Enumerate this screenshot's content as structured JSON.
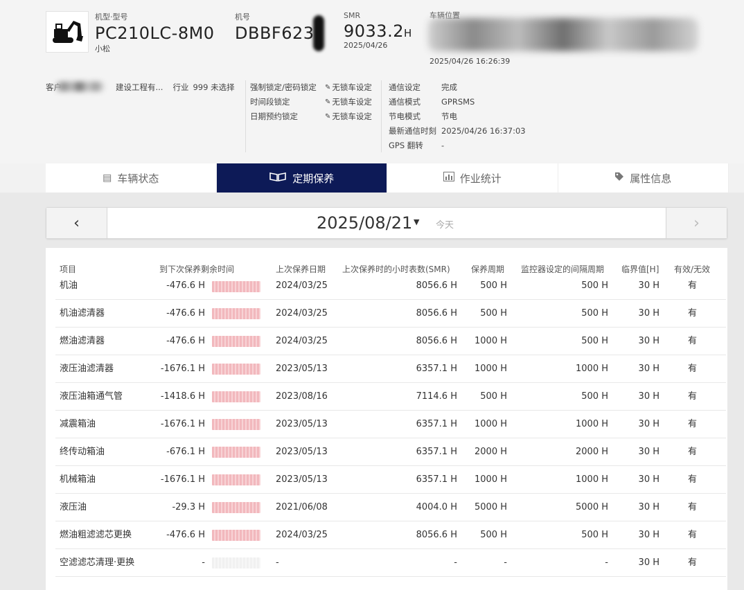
{
  "colors": {
    "active_tab": "#0d1a57",
    "bar": "#f2b8bd"
  },
  "vehicle": {
    "model_label": "机型·型号",
    "model": "PC210LC-8M0",
    "maker": "小松",
    "machine_no_label": "机号",
    "machine_no": "DBBF623",
    "smr_label": "SMR",
    "smr_value": "9033.2",
    "smr_unit": "H",
    "smr_date": "2025/04/26",
    "location_label": "车辆位置",
    "location_time": "2025/04/26 16:26:39"
  },
  "info": {
    "customer_label": "客户",
    "customer_value": "建设工程有...",
    "industry_label": "行业",
    "industry_value": "999 未选择",
    "locks": [
      {
        "label": "强制锁定/密码锁定",
        "value": "无锁车设定"
      },
      {
        "label": "时间段锁定",
        "value": "无锁车设定"
      },
      {
        "label": "日期预约锁定",
        "value": "无锁车设定"
      }
    ],
    "comm": [
      {
        "label": "通信设定",
        "value": "完成"
      },
      {
        "label": "通信模式",
        "value": "GPRSMS"
      },
      {
        "label": "节电模式",
        "value": "节电"
      },
      {
        "label": "最新通信时刻",
        "value": "2025/04/26 16:37:03"
      },
      {
        "label": "GPS 翻转",
        "value": "-"
      }
    ]
  },
  "tabs": [
    {
      "label": "车辆状态",
      "icon": "document-icon"
    },
    {
      "label": "定期保养",
      "icon": "book-icon"
    },
    {
      "label": "作业统计",
      "icon": "bar-chart-icon"
    },
    {
      "label": "属性信息",
      "icon": "tag-icon"
    }
  ],
  "datebar": {
    "date": "2025/08/21",
    "today": "今天"
  },
  "table": {
    "headers": [
      "项目",
      "到下次保养剩余时间",
      "上次保养日期",
      "上次保养时的小时表数(SMR)",
      "保养周期",
      "监控器设定的间隔周期",
      "临界值[H]",
      "有效/无效"
    ],
    "rows": [
      {
        "item": "机油",
        "remain": "-476.6 H",
        "last_date": "2024/03/25",
        "smr": "8056.6 H",
        "cycle": "500 H",
        "monitor": "500 H",
        "limit": "30 H",
        "valid": "有"
      },
      {
        "item": "机油滤清器",
        "remain": "-476.6 H",
        "last_date": "2024/03/25",
        "smr": "8056.6 H",
        "cycle": "500 H",
        "monitor": "500 H",
        "limit": "30 H",
        "valid": "有"
      },
      {
        "item": "燃油滤清器",
        "remain": "-476.6 H",
        "last_date": "2024/03/25",
        "smr": "8056.6 H",
        "cycle": "1000 H",
        "monitor": "500 H",
        "limit": "30 H",
        "valid": "有"
      },
      {
        "item": "液压油滤清器",
        "remain": "-1676.1 H",
        "last_date": "2023/05/13",
        "smr": "6357.1 H",
        "cycle": "1000 H",
        "monitor": "1000 H",
        "limit": "30 H",
        "valid": "有"
      },
      {
        "item": "液压油箱通气管",
        "remain": "-1418.6 H",
        "last_date": "2023/08/16",
        "smr": "7114.6 H",
        "cycle": "500 H",
        "monitor": "500 H",
        "limit": "30 H",
        "valid": "有"
      },
      {
        "item": "减震箱油",
        "remain": "-1676.1 H",
        "last_date": "2023/05/13",
        "smr": "6357.1 H",
        "cycle": "1000 H",
        "monitor": "1000 H",
        "limit": "30 H",
        "valid": "有"
      },
      {
        "item": "终传动箱油",
        "remain": "-676.1 H",
        "last_date": "2023/05/13",
        "smr": "6357.1 H",
        "cycle": "2000 H",
        "monitor": "2000 H",
        "limit": "30 H",
        "valid": "有"
      },
      {
        "item": "机械箱油",
        "remain": "-1676.1 H",
        "last_date": "2023/05/13",
        "smr": "6357.1 H",
        "cycle": "1000 H",
        "monitor": "1000 H",
        "limit": "30 H",
        "valid": "有"
      },
      {
        "item": "液压油",
        "remain": "-29.3 H",
        "last_date": "2021/06/08",
        "smr": "4004.0 H",
        "cycle": "5000 H",
        "monitor": "5000 H",
        "limit": "30 H",
        "valid": "有"
      },
      {
        "item": "燃油粗滤滤芯更换",
        "remain": "-476.6 H",
        "last_date": "2024/03/25",
        "smr": "8056.6 H",
        "cycle": "500 H",
        "monitor": "500 H",
        "limit": "30 H",
        "valid": "有"
      },
      {
        "item": "空滤滤芯清理·更换",
        "remain": "-",
        "last_date": "-",
        "smr": "-",
        "cycle": "-",
        "monitor": "-",
        "limit": "30 H",
        "valid": "有",
        "empty_bar": true
      }
    ]
  }
}
